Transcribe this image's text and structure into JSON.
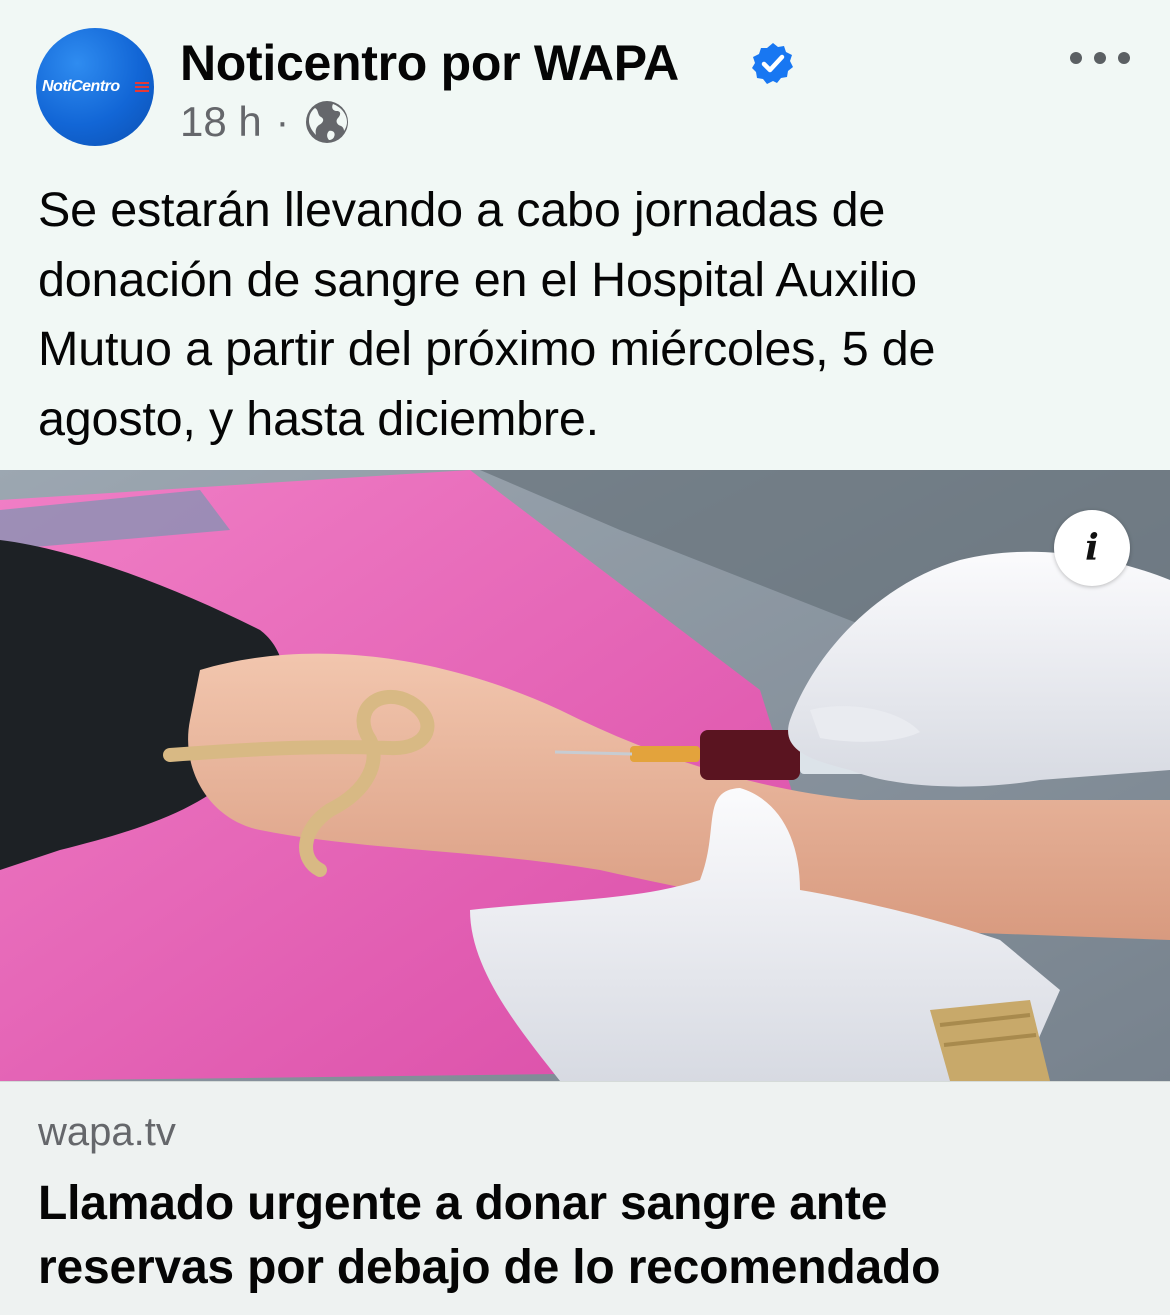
{
  "post": {
    "avatar_text": "NotiCentro",
    "page_name": "Noticentro por WAPA",
    "time": "18 h",
    "separator": "·",
    "text_lines": [
      "Se estarán llevando a cabo jornadas de",
      "donación de sangre en el Hospital Auxilio",
      "Mutuo a partir del próximo miércoles, 5 de",
      "agosto, y hasta diciembre."
    ],
    "info_label": "i",
    "icons": {
      "verified": "verified-badge-icon",
      "audience": "globe-icon",
      "more": "more-options-icon"
    }
  },
  "link_preview": {
    "domain": "wapa.tv",
    "title_lines": [
      "Llamado urgente a donar sangre ante",
      "reservas por debajo de lo recomendado"
    ]
  },
  "colors": {
    "background": "#f1f8f5",
    "secondary_text": "#65676b",
    "verified_blue": "#1877f2",
    "avatar_blue": "#1266d6"
  }
}
